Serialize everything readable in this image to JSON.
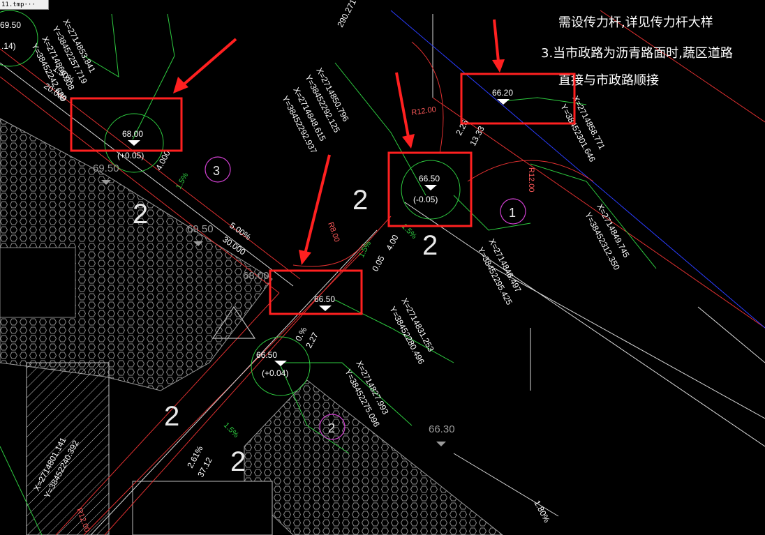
{
  "window": {
    "tab_title": "11.tmp···"
  },
  "notes": {
    "line1": "需设传力杆,详见传力杆大样",
    "line2": "3.当市政路为沥青路面时,蔬区道路",
    "line3": "直接与市政路顺接"
  },
  "elevations": {
    "e_68_00": "68.00",
    "e_68_00_adj": "(+0.05)",
    "e_66_50_a": "66.50",
    "e_66_50_a_adj": "(-0.05)",
    "e_66_20": "66.20",
    "e_66_50_b": "66.50",
    "e_66_50_c": "66.50",
    "e_66_50_c_adj": "(+0.04)",
    "g_69_50_a": "69.50",
    "g_69_50_b": "69.50",
    "g_68_00": "68.00",
    "g_66_30": "66.30",
    "top_left_a": "69.50",
    "top_left_b": ".14)"
  },
  "coords": {
    "c1x": "X=2714853.841",
    "c1y": "Y=38452257.719",
    "c2x": "X=2714866.908",
    "c2y": "Y=38452242.638",
    "c3x": "X=2714850.796",
    "c3y": "Y=38452292.125",
    "c4x": "X=2714848.615",
    "c4y": "Y=38452292.937",
    "c5x": "X=2714858.771",
    "c5y": "Y=38452301.646",
    "c6x": "X=2714849.745",
    "c6y": "Y=38452312.350",
    "c7x": "X=2714848.497",
    "c7y": "Y=38452295.425",
    "c8x": "X=2714831.253",
    "c8y": "Y=38452280.496",
    "c9x": "X=2714827.993",
    "c9y": "Y=38452275.096",
    "c10x": "X=2714801.141",
    "c10y": "Y=38452240.392",
    "top": "290.271"
  },
  "dims": {
    "d_150": "1.50%",
    "d_2000": "20.000",
    "d_500": "5.00%",
    "d_3000": "30.000",
    "d_400a": "4.000",
    "d_400b": "4.00",
    "d_005": "0.05",
    "d_227": "2.27",
    "d_261": "2.61%",
    "d_3712": "37.12",
    "d_225": "2.25",
    "d_1333": "13.33",
    "d_180": "1.80%",
    "d_pct_a": "1.5%",
    "d_pct_b": "1.5%",
    "d_pct_c": "1.5%",
    "d_pct_d": "1.5%",
    "d_pct_e": "0.%"
  },
  "radii": {
    "r12a": "R12.00",
    "r12b": "R12.00",
    "r8": "R8.00",
    "r12c": "R12.00"
  },
  "markers": {
    "m1": "1",
    "m2": "2",
    "m3": "3"
  },
  "symbols": {
    "s2a": "2",
    "s2b": "2",
    "s2c": "2",
    "s2d": "2",
    "s2e": "2"
  }
}
